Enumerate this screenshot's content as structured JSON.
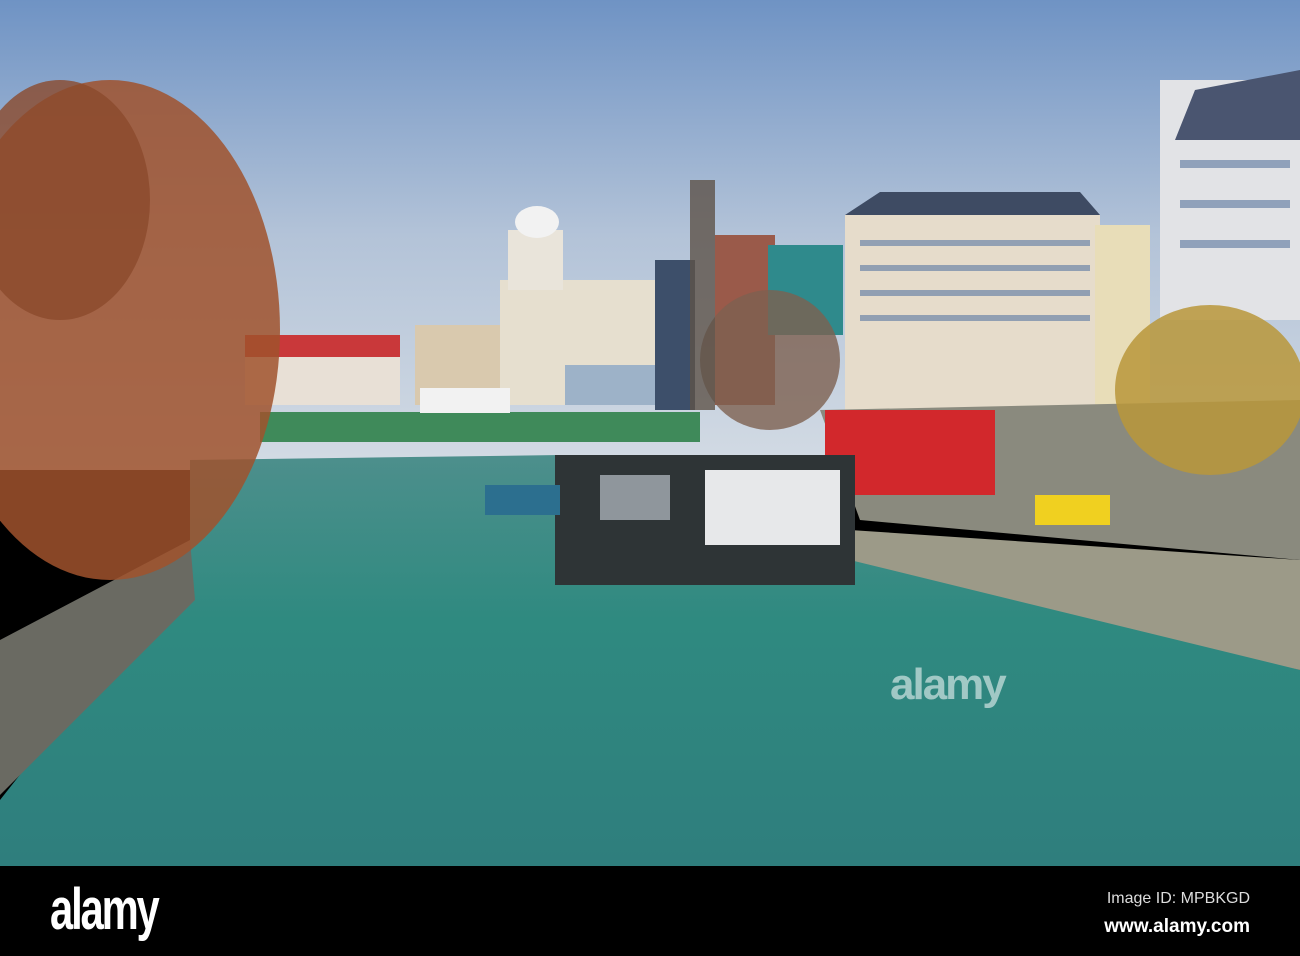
{
  "watermark": "alamy",
  "footer": {
    "logo": "alamy",
    "image_id": "Image ID: MPBKGD",
    "website": "www.alamy.com"
  },
  "colors": {
    "sky_top": "#6f93c4",
    "sky_bottom": "#cfd8e3",
    "water": "#3a8a84",
    "tree": "#a0522d"
  }
}
